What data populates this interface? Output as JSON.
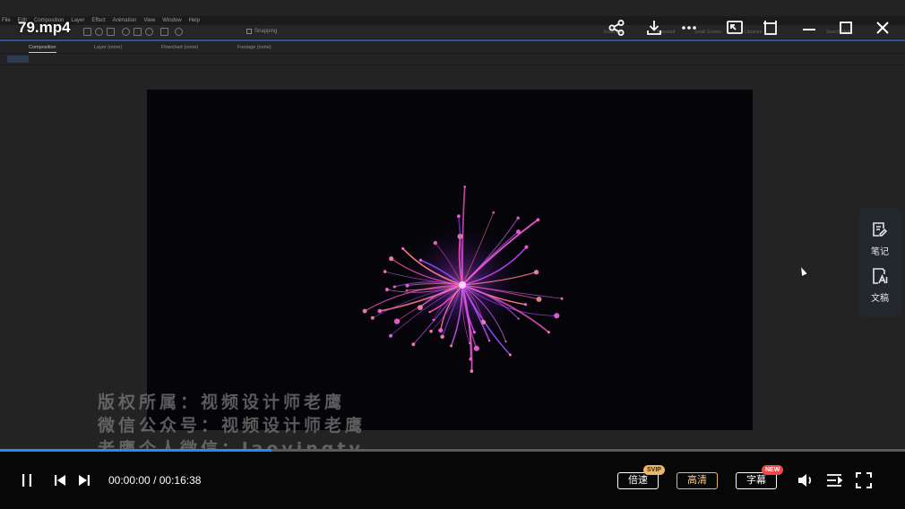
{
  "player": {
    "file_title": "79.mp4",
    "current_time": "00:00:00",
    "separator": "/",
    "total_time": "00:16:38",
    "progress": 0.3,
    "accent_color": "#1f8cff",
    "buttons": {
      "speed": "倍速",
      "speed_badge": "SVIP",
      "quality": "高清",
      "subtitle": "字幕",
      "subtitle_badge": "NEW"
    },
    "side_panel": [
      {
        "icon": "note-icon",
        "label": "笔记"
      },
      {
        "icon": "transcript-icon",
        "label": "文稿"
      }
    ],
    "top_icons": [
      "share-icon",
      "download-icon",
      "more-icon",
      "picture-in-picture-icon",
      "pin-icon",
      "minimize-icon",
      "maximize-icon",
      "close-icon"
    ]
  },
  "video": {
    "watermark_lines": [
      "版权所属：视频设计师老鹰",
      "微信公众号：视频设计师老鹰",
      "老鹰个人微信：laoyingtv"
    ],
    "ae_menu": [
      "File",
      "Edit",
      "Composition",
      "Layer",
      "Effect",
      "Animation",
      "View",
      "Window",
      "Help"
    ],
    "ae_panels": [
      "Composition",
      "Layer (none)",
      "Flowchart (none)",
      "Footage (none)"
    ],
    "ae_snapping": "Snapping",
    "ae_workspaces": [
      "Essentials",
      "Standard",
      "Small Screen",
      "Libraries"
    ],
    "ae_search": "Search Help"
  }
}
